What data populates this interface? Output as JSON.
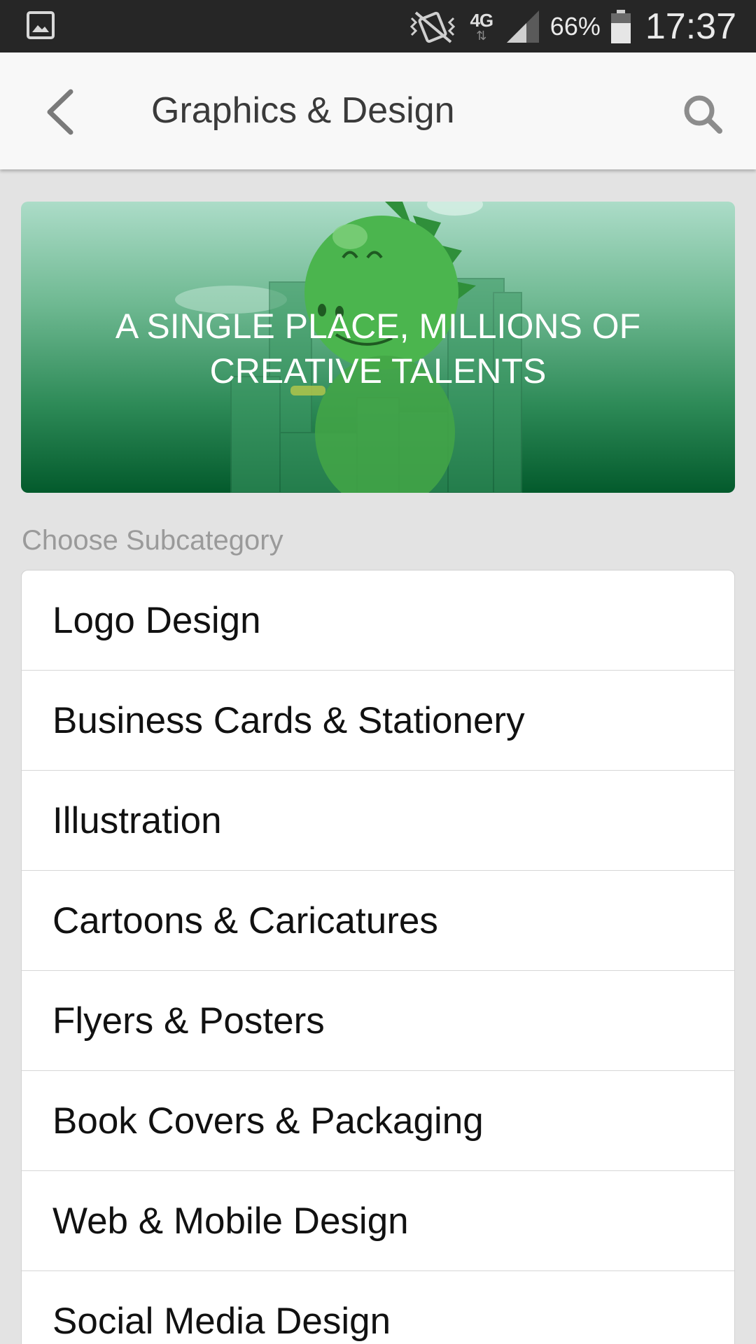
{
  "status_bar": {
    "left_icon": "gallery-icon",
    "battery_percent": "66%",
    "time": "17:37",
    "network": "4G",
    "network_arrows": "⇅",
    "icons": [
      "vibrate-mute-icon",
      "network-4g-icon",
      "signal-icon",
      "battery-icon"
    ]
  },
  "app_bar": {
    "title": "Graphics & Design",
    "back_icon": "chevron-left-icon",
    "search_icon": "search-icon"
  },
  "banner": {
    "headline": "A SINGLE PLACE, MILLIONS OF CREATIVE TALENTS",
    "colors": {
      "top": "#acdcc8",
      "bottom": "#035a2c"
    }
  },
  "section": {
    "label": "Choose Subcategory"
  },
  "subcategories": [
    {
      "label": "Logo Design"
    },
    {
      "label": "Business Cards & Stationery"
    },
    {
      "label": "Illustration"
    },
    {
      "label": "Cartoons & Caricatures"
    },
    {
      "label": "Flyers & Posters"
    },
    {
      "label": "Book Covers & Packaging"
    },
    {
      "label": "Web & Mobile Design"
    },
    {
      "label": "Social Media Design"
    }
  ]
}
